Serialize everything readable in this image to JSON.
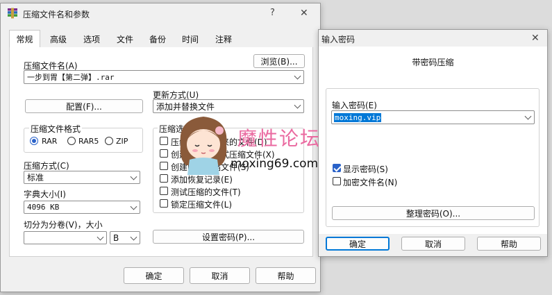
{
  "main_dialog": {
    "title": "压缩文件名和参数",
    "help_glyph": "?",
    "close_glyph": "✕",
    "tabs": [
      "常规",
      "高级",
      "选项",
      "文件",
      "备份",
      "时间",
      "注释"
    ],
    "archive_name_label": "压缩文件名(A)",
    "browse_button": "浏览(B)...",
    "archive_name_value": "一步到胃【第二弹】.rar",
    "update_mode_label": "更新方式(U)",
    "update_mode_value": "添加并替换文件",
    "profiles_button": "配置(F)...",
    "format_group_label": "压缩文件格式",
    "formats": [
      {
        "label": "RAR",
        "selected": true
      },
      {
        "label": "RAR5",
        "selected": false
      },
      {
        "label": "ZIP",
        "selected": false
      }
    ],
    "options_group_label": "压缩选项",
    "options": [
      {
        "label": "压缩后删除原来的文件(D)",
        "checked": false
      },
      {
        "label": "创建自解压格式压缩文件(X)",
        "checked": false
      },
      {
        "label": "创建固实压缩文件(S)",
        "checked": false
      },
      {
        "label": "添加恢复记录(E)",
        "checked": false
      },
      {
        "label": "测试压缩的文件(T)",
        "checked": false
      },
      {
        "label": "锁定压缩文件(L)",
        "checked": false
      }
    ],
    "method_label": "压缩方式(C)",
    "method_value": "标准",
    "dict_label": "字典大小(I)",
    "dict_value": "4096 KB",
    "split_label": "切分为分卷(V)，大小",
    "split_value": "",
    "split_unit": "B",
    "set_password_button": "设置密码(P)...",
    "ok_button": "确定",
    "cancel_button": "取消",
    "help_button": "帮助"
  },
  "password_dialog": {
    "title": "输入密码",
    "close_glyph": "✕",
    "heading": "带密码压缩",
    "password_label": "输入密码(E)",
    "password_value": "moxing.vip",
    "show_password_label": "显示密码(S)",
    "show_password_checked": true,
    "encrypt_names_label": "加密文件名(N)",
    "encrypt_names_checked": false,
    "organize_button": "整理密码(O)...",
    "ok_button": "确定",
    "cancel_button": "取消",
    "help_button": "帮助"
  },
  "watermark": {
    "text": "魔性论坛",
    "url": "moxing69.com"
  },
  "colors": {
    "accent": "#2a62c9",
    "selection": "#0078d7",
    "watermark_pink": "#ea6aa0"
  }
}
